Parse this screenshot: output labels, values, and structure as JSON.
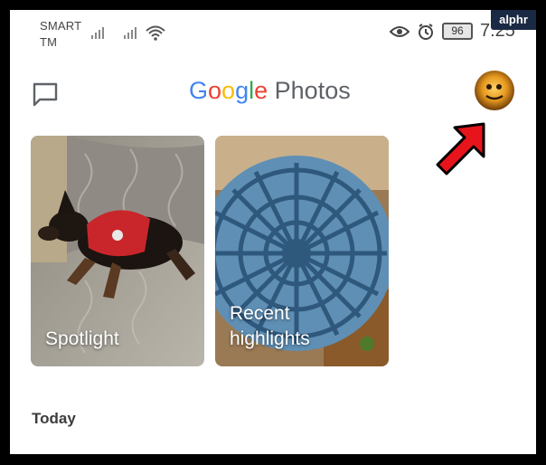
{
  "status_bar": {
    "carrier_line1": "SMART",
    "carrier_line2": "TM",
    "battery": "96",
    "time": "7:25",
    "icons": [
      "signal-icon",
      "signal-icon",
      "wifi-icon",
      "eye-icon",
      "alarm-icon",
      "battery-icon"
    ]
  },
  "watermark": "alphr",
  "header": {
    "logo_letters": [
      "G",
      "o",
      "o",
      "g",
      "l",
      "e"
    ],
    "logo_colors": [
      "#4285F4",
      "#EA4335",
      "#FBBC05",
      "#4285F4",
      "#34A853",
      "#EA4335"
    ],
    "logo_product": "Photos"
  },
  "cards": [
    {
      "label": "Spotlight"
    },
    {
      "label": "Recent\nhighlights"
    }
  ],
  "section": {
    "title": "Today"
  },
  "colors": {
    "annotation_arrow": "#e8141b"
  }
}
